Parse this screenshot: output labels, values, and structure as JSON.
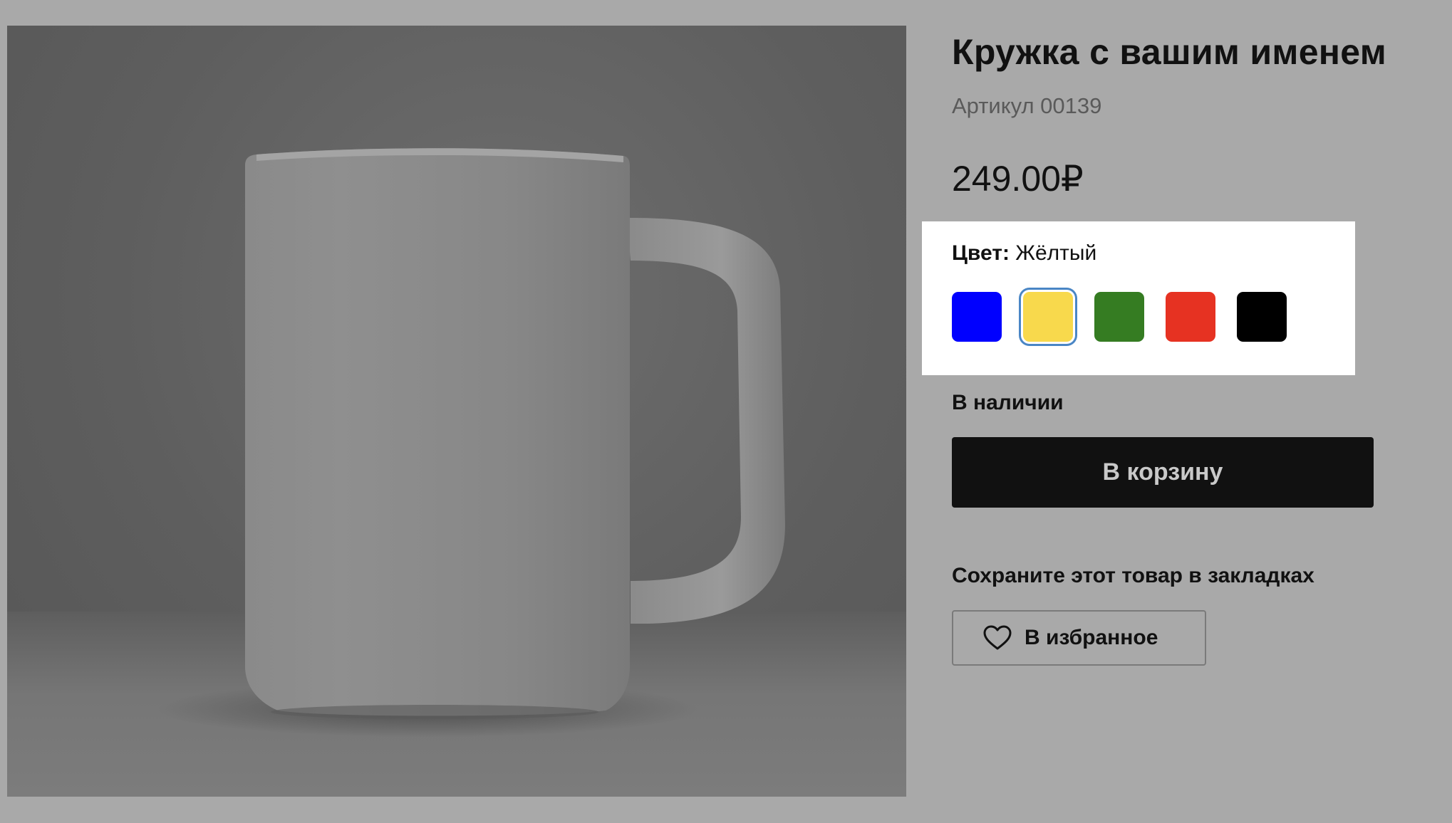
{
  "product": {
    "title": "Кружка с вашим именем",
    "sku": "Артикул 00139",
    "price": "249.00₽",
    "image_icon": "mug-photo"
  },
  "color": {
    "label": "Цвет:",
    "selected": "Жёлтый",
    "options": [
      {
        "name": "blue",
        "hex": "#0000ff"
      },
      {
        "name": "yellow",
        "hex": "#f8d94c",
        "selected": true
      },
      {
        "name": "green",
        "hex": "#357c22"
      },
      {
        "name": "red",
        "hex": "#e63222"
      },
      {
        "name": "black",
        "hex": "#000000"
      }
    ]
  },
  "stock": "В наличии",
  "cart_button": "В корзину",
  "bookmark_text": "Сохраните этот товар в закладках",
  "favorite_button": {
    "label": "В избранное",
    "icon": "heart-icon"
  }
}
